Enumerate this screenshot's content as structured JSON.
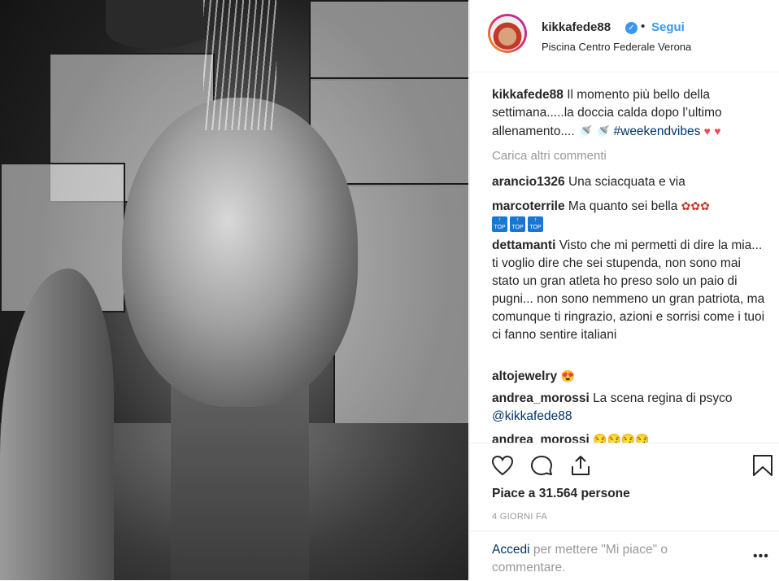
{
  "post": {
    "username": "kikkafede88",
    "follow_label": "Segui",
    "dot": "•",
    "location": "Piscina Centro Federale Verona",
    "caption_text": "Il momento più bello della settimana.....la doccia calda dopo l’ultimo allenamento....",
    "caption_hashtag": "#weekendvibes"
  },
  "comments": {
    "load_more": "Carica altri commenti",
    "items": [
      {
        "user": "arancio1326",
        "text": "Una sciacquata e via"
      },
      {
        "user": "marcoterrile",
        "text": "Ma quanto sei bella"
      },
      {
        "user": "dettamanti",
        "text": "Visto che mi permetti di dire la mia... ti voglio dire che sei stupenda, non sono mai stato un gran atleta ho preso solo un paio di pugni... non sono nemmeno un gran patriota, ma comunque ti ringrazio, azioni e sorrisi come i tuoi ci fanno sentire italiani"
      },
      {
        "user": "altojewelry",
        "text": ""
      },
      {
        "user": "andrea_morossi",
        "text": "La scena regina di psyco",
        "mention": "@kikkafede88"
      },
      {
        "user": "andrea_morossi",
        "text": ""
      }
    ]
  },
  "actions": {
    "likes": "Piace a 31.564 persone",
    "time": "4 GIORNI FA"
  },
  "login": {
    "link": "Accedi",
    "text": "per mettere \"Mi piace\" o commentare.",
    "more": "•••"
  },
  "icons": [
    "heart-icon",
    "comment-icon",
    "share-icon",
    "bookmark-icon",
    "verified-icon"
  ],
  "colors": {
    "link": "#3897f0",
    "dark_link": "#003569",
    "muted": "#999999",
    "heart": "#ed4956"
  }
}
